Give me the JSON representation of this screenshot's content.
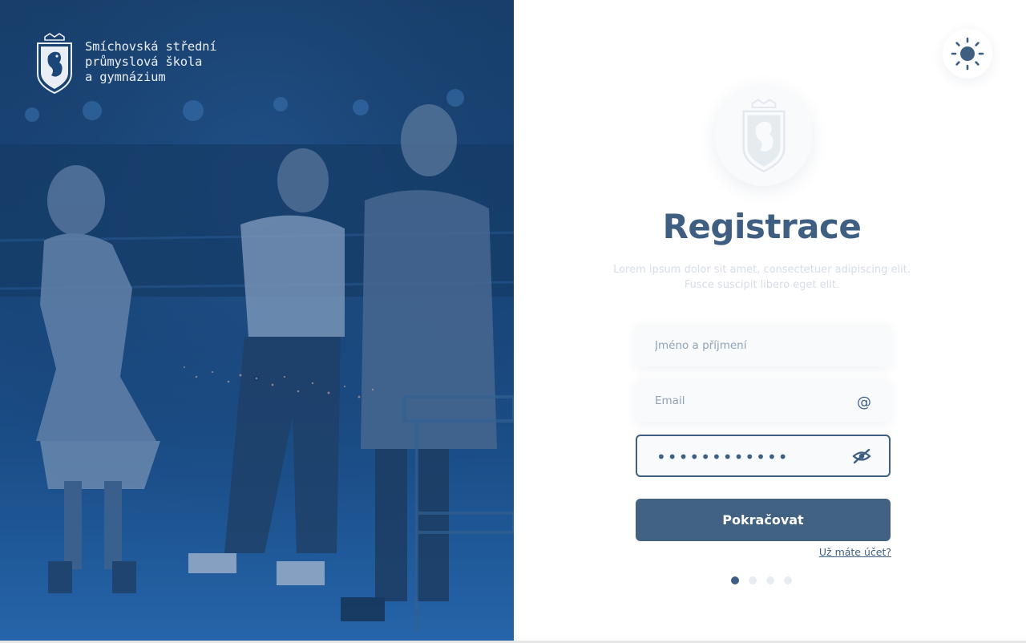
{
  "brand": {
    "lines": [
      "Smíchovská střední",
      "průmyslová škola",
      "a gymnázium"
    ]
  },
  "colors": {
    "primary": "#3e5f82",
    "button": "#416282",
    "hero_overlay": "#1b4778",
    "field_bg": "#f8fafc"
  },
  "icons": {
    "theme": "sun-icon",
    "email": "at-sign-icon",
    "password": "eye-off-icon",
    "crest": "school-crest-icon"
  },
  "form": {
    "title": "Registrace",
    "subtitle_line1": "Lorem ipsum dolor sit amet, consectetuer adipiscing elit.",
    "subtitle_line2": "Fusce suscipit libero eget elit.",
    "name": {
      "placeholder": "Jméno a příjmení",
      "value": ""
    },
    "email": {
      "placeholder": "Email",
      "value": "",
      "icon_text": "@"
    },
    "password": {
      "value": "••••••••••••"
    },
    "submit_label": "Pokračovat",
    "login_link": "Už máte účet?"
  },
  "steps": {
    "total": 4,
    "active": 1
  }
}
